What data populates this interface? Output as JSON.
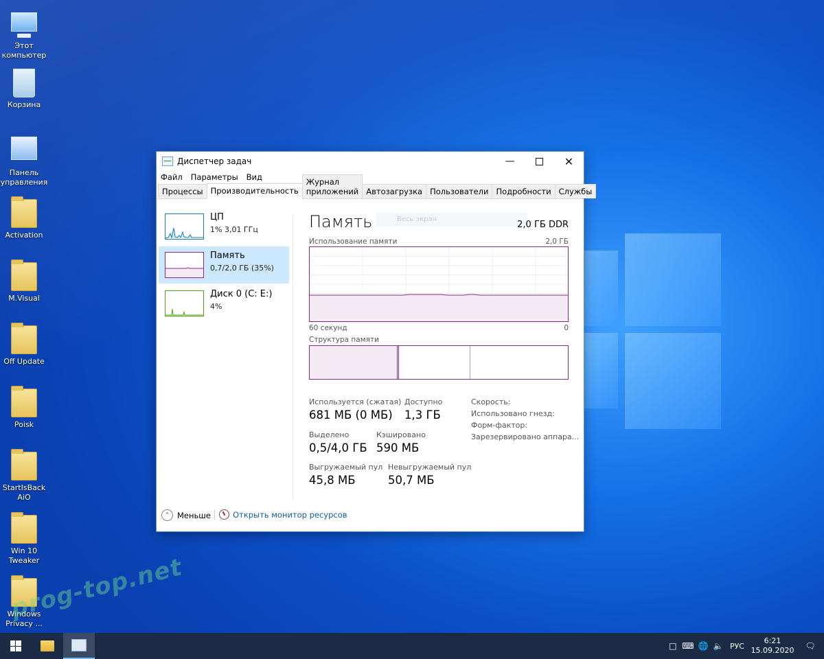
{
  "desktop": {
    "icons": [
      {
        "label": "Этот компьютер",
        "icon": "computer-icon"
      },
      {
        "label": "Корзина",
        "icon": "recycle-bin-icon"
      },
      {
        "label": "Панель управления",
        "icon": "control-panel-icon"
      },
      {
        "label": "Activation",
        "icon": "folder-icon"
      },
      {
        "label": "M.Visual",
        "icon": "folder-icon"
      },
      {
        "label": "Off Update",
        "icon": "folder-icon"
      },
      {
        "label": "Poisk",
        "icon": "folder-icon"
      },
      {
        "label": "StartIsBack AiO",
        "icon": "folder-icon"
      },
      {
        "label": "Win 10 Tweaker",
        "icon": "folder-icon"
      },
      {
        "label": "Windows Privacy ...",
        "icon": "folder-icon"
      }
    ],
    "watermark": "prog-top.net"
  },
  "window": {
    "title": "Диспетчер задач",
    "menu": [
      "Файл",
      "Параметры",
      "Вид"
    ],
    "tabs": [
      {
        "label": "Процессы",
        "active": false
      },
      {
        "label": "Производительность",
        "active": true
      },
      {
        "label": "Журнал приложений",
        "active": false
      },
      {
        "label": "Автозагрузка",
        "active": false
      },
      {
        "label": "Пользователи",
        "active": false
      },
      {
        "label": "Подробности",
        "active": false
      },
      {
        "label": "Службы",
        "active": false
      }
    ],
    "sidebar": [
      {
        "name": "ЦП",
        "sub": "1% 3,01 ГГц",
        "color": "#117dbb"
      },
      {
        "name": "Память",
        "sub": "0,7/2,0 ГБ (35%)",
        "color": "#8b278b"
      },
      {
        "name": "Диск 0 (C: E:)",
        "sub": "4%",
        "color": "#4da60c"
      }
    ],
    "memory": {
      "title": "Память",
      "type": "2,0 ГБ DDR",
      "ghost_text": "Весь экран",
      "usage_label": "Использование памяти",
      "usage_max": "2,0 ГБ",
      "time_left": "60 секунд",
      "time_right": "0",
      "structure_label": "Структура памяти",
      "usage_fraction": 0.35,
      "stats": {
        "in_use_label": "Используется (сжатая)",
        "in_use_value": "681 МБ (0 МБ)",
        "available_label": "Доступно",
        "available_value": "1,3 ГБ",
        "committed_label": "Выделено",
        "committed_value": "0,5/4,0 ГБ",
        "cached_label": "Кэшировано",
        "cached_value": "590 МБ",
        "paged_label": "Выгружаемый пул",
        "paged_value": "45,8 МБ",
        "nonpaged_label": "Невыгружаемый пул",
        "nonpaged_value": "50,7 МБ"
      },
      "info": [
        "Скорость:",
        "Использовано гнезд:",
        "Форм-фактор:",
        "Зарезервировано аппара..."
      ]
    },
    "footer": {
      "less": "Меньше",
      "open_monitor": "Открыть монитор ресурсов"
    }
  },
  "taskbar": {
    "lang": "РУС",
    "time": "6:21",
    "date": "15.09.2020"
  },
  "colors": {
    "memory": "#8b278b",
    "cpu": "#117dbb",
    "disk": "#4da60c",
    "selected": "#cce8ff"
  }
}
